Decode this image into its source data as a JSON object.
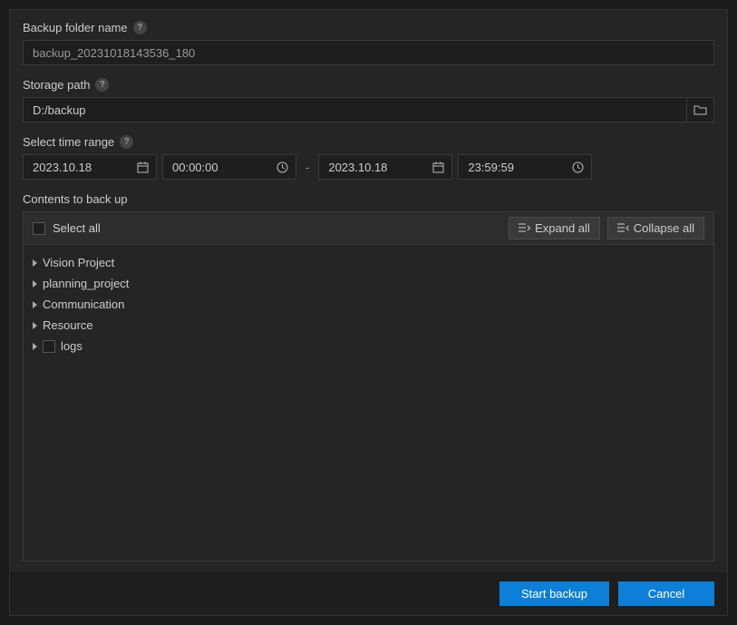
{
  "labels": {
    "backup_folder_name": "Backup folder name",
    "storage_path": "Storage path",
    "select_time_range": "Select time range",
    "contents_to_back_up": "Contents to back up"
  },
  "inputs": {
    "backup_folder_name": "backup_20231018143536_180",
    "storage_path": "D:/backup",
    "start_date": "2023.10.18",
    "start_time": "00:00:00",
    "end_date": "2023.10.18",
    "end_time": "23:59:59"
  },
  "toolbar": {
    "select_all": "Select all",
    "expand_all": "Expand all",
    "collapse_all": "Collapse all"
  },
  "tree": {
    "items": [
      {
        "label": "Vision Project",
        "has_checkbox": false
      },
      {
        "label": "planning_project",
        "has_checkbox": false
      },
      {
        "label": "Communication",
        "has_checkbox": false
      },
      {
        "label": "Resource",
        "has_checkbox": false
      },
      {
        "label": "logs",
        "has_checkbox": true
      }
    ]
  },
  "footer": {
    "start_backup": "Start backup",
    "cancel": "Cancel"
  },
  "range_separator": "-"
}
